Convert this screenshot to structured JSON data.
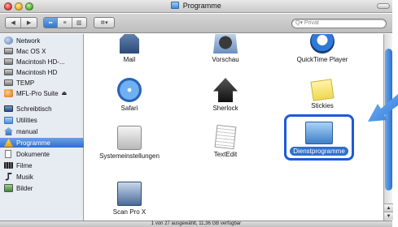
{
  "window": {
    "title": "Programme"
  },
  "toolbar": {
    "back": "◀",
    "forward": "▶",
    "view_icons": "▪▪",
    "view_list": "≡",
    "view_columns": "▥",
    "action": "✲▾",
    "search_placeholder": "Privat",
    "search_icon": "Q▾"
  },
  "sidebar": {
    "items": [
      {
        "label": "Network",
        "icon": "network-icon"
      },
      {
        "label": "Mac OS X",
        "icon": "drive-icon"
      },
      {
        "label": "Macintosh HD-...",
        "icon": "drive-icon"
      },
      {
        "label": "Macintosh HD",
        "icon": "drive-icon"
      },
      {
        "label": "TEMP",
        "icon": "drive-icon"
      },
      {
        "label": "MFL-Pro Suite",
        "icon": "disk-image-icon",
        "eject": "⏏"
      },
      {
        "label": "Schreibtisch",
        "icon": "desktop-icon"
      },
      {
        "label": "Utilities",
        "icon": "folder-icon"
      },
      {
        "label": "manual",
        "icon": "home-icon"
      },
      {
        "label": "Programme",
        "icon": "applications-icon",
        "selected": true
      },
      {
        "label": "Dokumente",
        "icon": "documents-icon"
      },
      {
        "label": "Filme",
        "icon": "movies-icon"
      },
      {
        "label": "Musik",
        "icon": "music-icon"
      },
      {
        "label": "Bilder",
        "icon": "pictures-icon"
      }
    ]
  },
  "content": {
    "items": [
      {
        "label": "Mail",
        "icon": "mail-icon"
      },
      {
        "label": "Vorschau",
        "icon": "preview-icon"
      },
      {
        "label": "QuickTime Player",
        "icon": "quicktime-icon"
      },
      {
        "label": "Safari",
        "icon": "safari-icon"
      },
      {
        "label": "Sherlock",
        "icon": "sherlock-icon"
      },
      {
        "label": "Stickies",
        "icon": "stickies-icon"
      },
      {
        "label": "Systemeinstellungen",
        "icon": "system-preferences-icon",
        "glyph": ""
      },
      {
        "label": "TextEdit",
        "icon": "textedit-icon"
      },
      {
        "label": "Dienstprogramme",
        "icon": "utilities-folder-icon",
        "selected": true
      },
      {
        "label": "Scan Pro X",
        "icon": "scan-icon"
      }
    ]
  },
  "status": {
    "text": "1 von 27 ausgewählt, 11,36 GB verfügbar"
  },
  "colors": {
    "selection": "#2f6fd0",
    "highlight_box": "#1c5bd8",
    "pointer": "#2f7de0"
  }
}
